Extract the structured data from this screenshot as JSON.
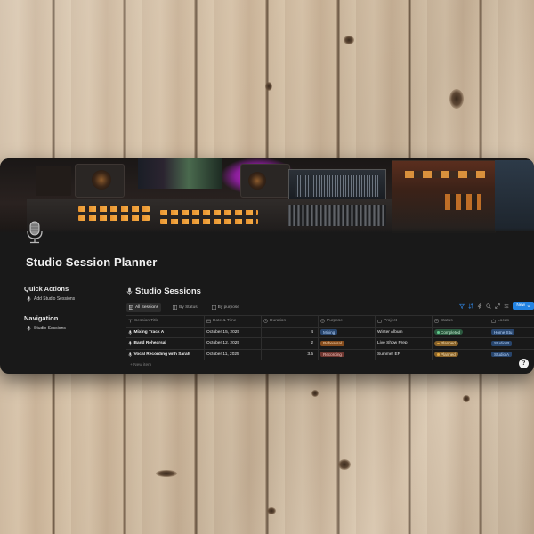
{
  "page": {
    "title": "Studio Session Planner",
    "help_label": "?"
  },
  "quick_actions": {
    "heading": "Quick Actions",
    "items": [
      {
        "label": "Add Studio Sessions",
        "icon": "mic-icon"
      }
    ]
  },
  "navigation": {
    "heading": "Navigation",
    "items": [
      {
        "label": "Studio Sessions",
        "icon": "mic-icon"
      }
    ]
  },
  "database": {
    "title": "Studio Sessions",
    "views": [
      {
        "label": "All Sessions",
        "active": true,
        "icon": "grid-icon"
      },
      {
        "label": "By Status",
        "active": false,
        "icon": "board-icon"
      },
      {
        "label": "By purpose",
        "active": false,
        "icon": "board-icon"
      }
    ],
    "new_button": "New",
    "columns": [
      {
        "label": "Session Title",
        "icon": "text-icon"
      },
      {
        "label": "Date & Time",
        "icon": "calendar-icon"
      },
      {
        "label": "Duration",
        "icon": "clock-icon"
      },
      {
        "label": "Purpose",
        "icon": "select-icon"
      },
      {
        "label": "Project",
        "icon": "folder-icon"
      },
      {
        "label": "Status",
        "icon": "status-icon"
      },
      {
        "label": "Locati",
        "icon": "home-icon"
      }
    ],
    "rows": [
      {
        "title": "Mixing Track A",
        "date": "October 15, 2025",
        "duration": "4",
        "purpose": "Mixing",
        "project": "Winter Album",
        "status": "Completed",
        "location": "Home Stu"
      },
      {
        "title": "Band Rehearsal",
        "date": "October 12, 2025",
        "duration": "2",
        "purpose": "Rehearsal",
        "project": "Live Show Prep",
        "status": "Planned",
        "location": "Studio B"
      },
      {
        "title": "Vocal Recording with Sarah",
        "date": "October 11, 2025",
        "duration": "3.5",
        "purpose": "Recording",
        "project": "Summer EP",
        "status": "Planned",
        "location": "Studio A"
      }
    ],
    "new_item": "+ New item"
  },
  "colors": {
    "accent": "#2383e2",
    "tag_mixing_bg": "#28456c",
    "tag_mixing_fg": "#b8d7ff",
    "tag_rehearsal_bg": "#854c1d",
    "tag_rehearsal_fg": "#f5d5b0",
    "tag_recording_bg": "#6e3630",
    "tag_recording_fg": "#f3c2bb",
    "status_completed_bg": "#2b593f",
    "status_completed_fg": "#bfe8cd",
    "status_planned_bg": "#89632a",
    "status_planned_fg": "#f7e0b3",
    "location_bg": "#28456c",
    "location_fg": "#b8d7ff"
  }
}
